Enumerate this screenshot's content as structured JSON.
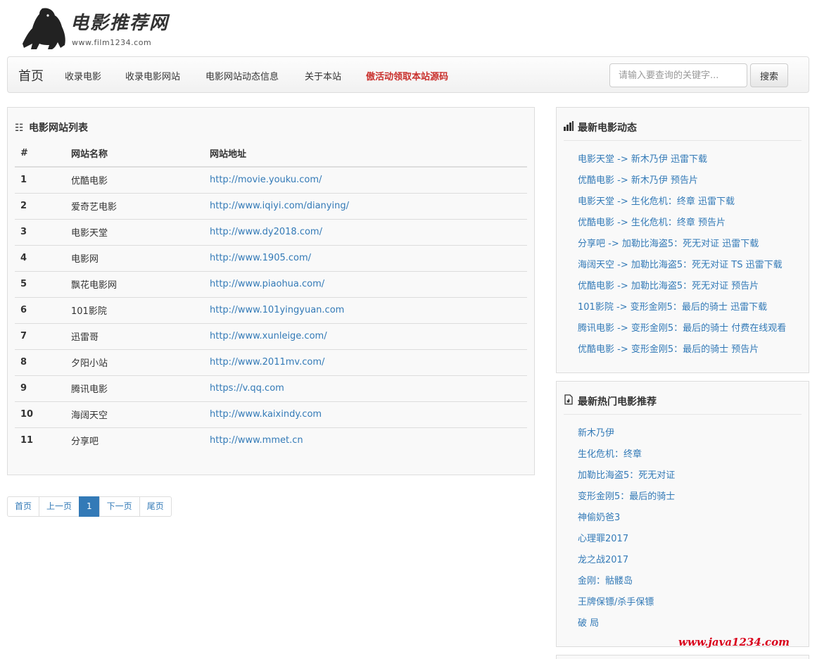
{
  "header": {
    "logo_title": "电影推荐网",
    "logo_subtitle": "www.film1234.com",
    "logo_icon": "gorilla-icon"
  },
  "nav": {
    "brand": "首页",
    "items": [
      "收录电影",
      "收录电影网站",
      "电影网站动态信息",
      "关于本站"
    ],
    "highlight": "傲活动领取本站源码",
    "search_placeholder": "请输入要查询的关键字...",
    "search_button": "搜索"
  },
  "site_list": {
    "title": "电影网站列表",
    "title_icon": "list-icon",
    "columns": [
      "#",
      "网站名称",
      "网站地址"
    ],
    "rows": [
      {
        "no": "1",
        "name": "优酷电影",
        "url": "http://movie.youku.com/"
      },
      {
        "no": "2",
        "name": "爱奇艺电影",
        "url": "http://www.iqiyi.com/dianying/"
      },
      {
        "no": "3",
        "name": "电影天堂",
        "url": "http://www.dy2018.com/"
      },
      {
        "no": "4",
        "name": "电影网",
        "url": "http://www.1905.com/"
      },
      {
        "no": "5",
        "name": "飘花电影网",
        "url": "http://www.piaohua.com/"
      },
      {
        "no": "6",
        "name": "101影院",
        "url": "http://www.101yingyuan.com"
      },
      {
        "no": "7",
        "name": "迅雷哥",
        "url": "http://www.xunleige.com/"
      },
      {
        "no": "8",
        "name": "夕阳小站",
        "url": "http://www.2011mv.com/"
      },
      {
        "no": "9",
        "name": "腾讯电影",
        "url": "https://v.qq.com"
      },
      {
        "no": "10",
        "name": "海阔天空",
        "url": "http://www.kaixindy.com"
      },
      {
        "no": "11",
        "name": "分享吧",
        "url": "http://www.mmet.cn"
      }
    ]
  },
  "pagination": {
    "first": "首页",
    "prev": "上一页",
    "current": "1",
    "next": "下一页",
    "last": "尾页"
  },
  "latest_news": {
    "title": "最新电影动态",
    "title_icon": "bar-chart-icon",
    "items": [
      "电影天堂 -> 新木乃伊 迅雷下载",
      "优酷电影 -> 新木乃伊 预告片",
      "电影天堂 -> 生化危机：终章 迅雷下载",
      "优酷电影 -> 生化危机：终章 预告片",
      "分享吧 -> 加勒比海盗5：死无对证 迅雷下载",
      "海阔天空 -> 加勒比海盗5：死无对证 TS 迅雷下载",
      "优酷电影 -> 加勒比海盗5：死无对证 预告片",
      "101影院 -> 变形金刚5：最后的骑士 迅雷下载",
      "腾讯电影 -> 变形金刚5：最后的骑士 付费在线观看",
      "优酷电影 -> 变形金刚5：最后的骑士 预告片"
    ]
  },
  "hot_movies": {
    "title": "最新热门电影推荐",
    "title_icon": "fire-icon",
    "items": [
      "新木乃伊",
      "生化危机：终章",
      "加勒比海盗5：死无对证",
      "变形金刚5：最后的骑士",
      "神偷奶爸3",
      "心理罪2017",
      "龙之战2017",
      "金刚：骷髅岛",
      "王牌保镖/杀手保镖",
      "破 局"
    ]
  },
  "watermark": "www.java1234.com"
}
